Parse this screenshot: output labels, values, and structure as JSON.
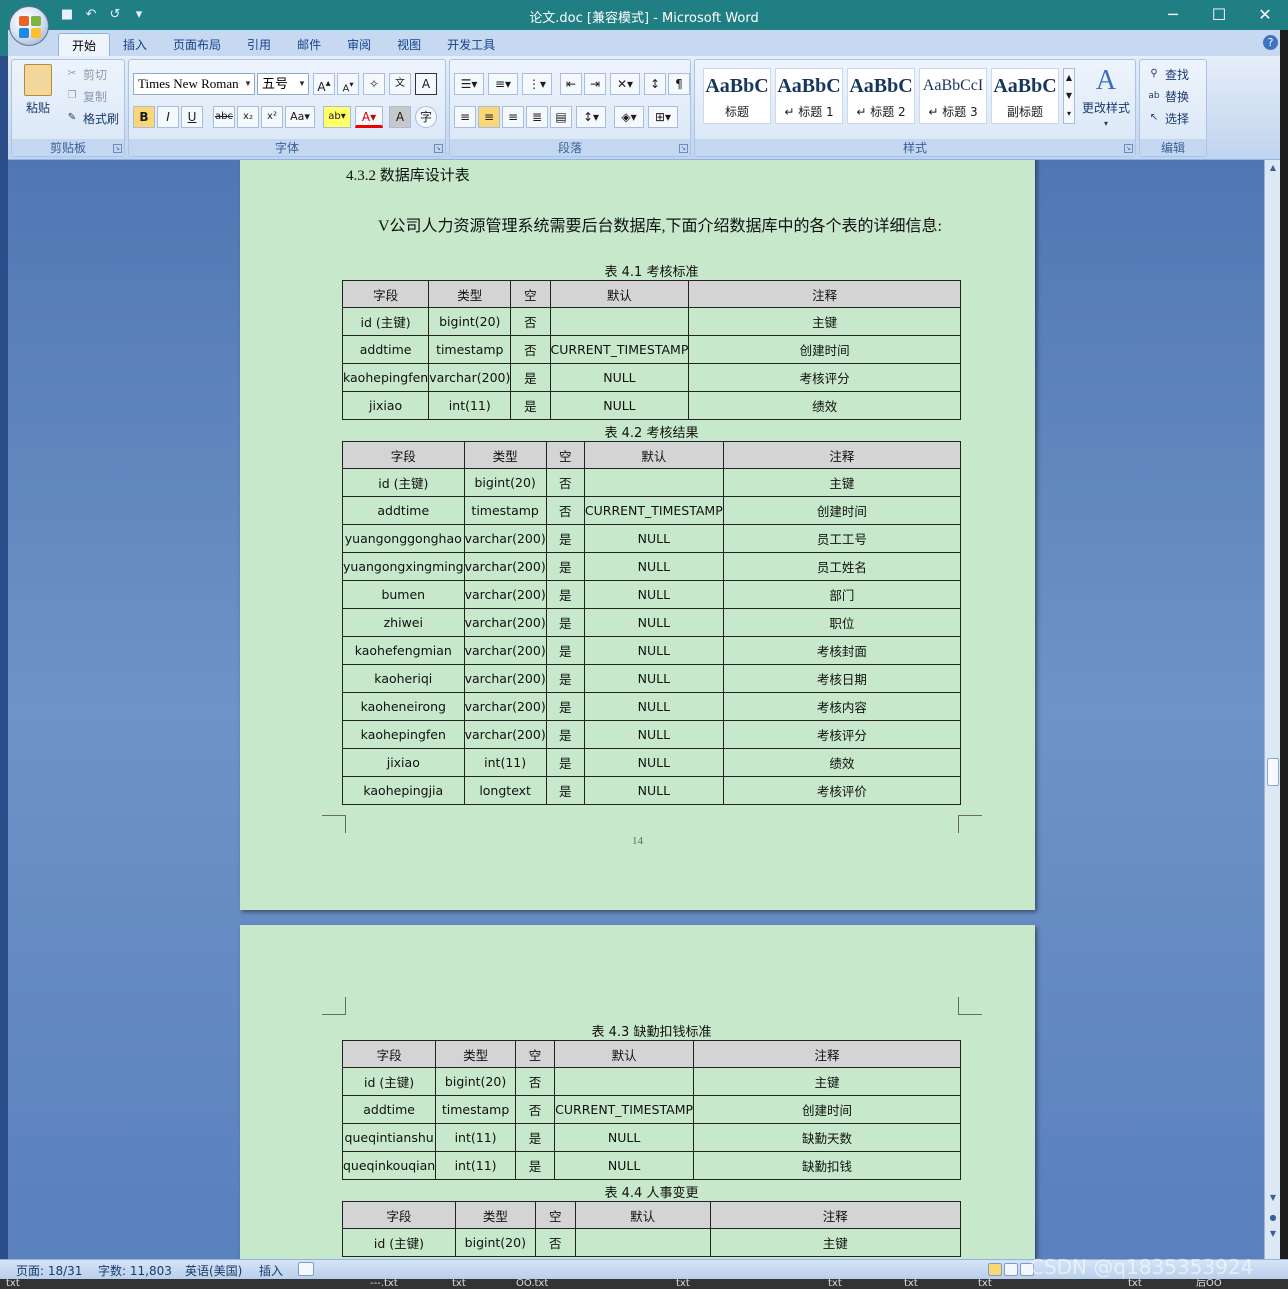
{
  "window": {
    "title": "论文.doc [兼容模式] - Microsoft Word",
    "min": "─",
    "max": "☐",
    "close": "✕"
  },
  "qat": {
    "save": "■",
    "undo": "↶",
    "redo": "↺",
    "customize": "▾"
  },
  "ribbon_tabs": [
    "开始",
    "插入",
    "页面布局",
    "引用",
    "邮件",
    "审阅",
    "视图",
    "开发工具"
  ],
  "clipboard": {
    "label": "剪贴板",
    "paste": "粘贴",
    "cut": "剪切",
    "copy": "复制",
    "format_painter": "格式刷"
  },
  "font": {
    "label": "字体",
    "font_name": "Times New Roman",
    "font_size": "五号"
  },
  "paragraph": {
    "label": "段落"
  },
  "styles": {
    "label": "样式",
    "items": [
      {
        "sample": "AaBbC",
        "name": "标题"
      },
      {
        "sample": "AaBbC",
        "name": "↵ 标题 1"
      },
      {
        "sample": "AaBbC",
        "name": "↵ 标题 2"
      },
      {
        "sample": "AaBbCcI",
        "name": "↵ 标题 3"
      },
      {
        "sample": "AaBbC",
        "name": "副标题"
      }
    ],
    "change_styles": "更改样式"
  },
  "editing": {
    "label": "编辑",
    "find": "查找",
    "replace": "替换",
    "select": "选择"
  },
  "page1": {
    "heading": "4.3.2 数据库设计表",
    "intro": "V公司人力资源管理系统需要后台数据库,下面介绍数据库中的各个表的详细信息:",
    "page_number": "14"
  },
  "columns": [
    "字段",
    "类型",
    "空",
    "默认",
    "注释"
  ],
  "tables": [
    {
      "caption": "表 4.1  考核标准",
      "rows": [
        [
          "id (主键)",
          "bigint(20)",
          "否",
          "",
          "主键"
        ],
        [
          "addtime",
          "timestamp",
          "否",
          "CURRENT_TIMESTAMP",
          "创建时间"
        ],
        [
          "kaohepingfen",
          "varchar(200)",
          "是",
          "NULL",
          "考核评分"
        ],
        [
          "jixiao",
          "int(11)",
          "是",
          "NULL",
          "绩效"
        ]
      ]
    },
    {
      "caption": "表 4.2  考核结果",
      "rows": [
        [
          "id (主键)",
          "bigint(20)",
          "否",
          "",
          "主键"
        ],
        [
          "addtime",
          "timestamp",
          "否",
          "CURRENT_TIMESTAMP",
          "创建时间"
        ],
        [
          "yuangonggonghao",
          "varchar(200)",
          "是",
          "NULL",
          "员工工号"
        ],
        [
          "yuangongxingming",
          "varchar(200)",
          "是",
          "NULL",
          "员工姓名"
        ],
        [
          "bumen",
          "varchar(200)",
          "是",
          "NULL",
          "部门"
        ],
        [
          "zhiwei",
          "varchar(200)",
          "是",
          "NULL",
          "职位"
        ],
        [
          "kaohefengmian",
          "varchar(200)",
          "是",
          "NULL",
          "考核封面"
        ],
        [
          "kaoheriqi",
          "varchar(200)",
          "是",
          "NULL",
          "考核日期"
        ],
        [
          "kaoheneirong",
          "varchar(200)",
          "是",
          "NULL",
          "考核内容"
        ],
        [
          "kaohepingfen",
          "varchar(200)",
          "是",
          "NULL",
          "考核评分"
        ],
        [
          "jixiao",
          "int(11)",
          "是",
          "NULL",
          "绩效"
        ],
        [
          "kaohepingjia",
          "longtext",
          "是",
          "NULL",
          "考核评价"
        ]
      ]
    },
    {
      "caption": "表 4.3  缺勤扣钱标准",
      "rows": [
        [
          "id (主键)",
          "bigint(20)",
          "否",
          "",
          "主键"
        ],
        [
          "addtime",
          "timestamp",
          "否",
          "CURRENT_TIMESTAMP",
          "创建时间"
        ],
        [
          "queqintianshu",
          "int(11)",
          "是",
          "NULL",
          "缺勤天数"
        ],
        [
          "queqinkouqian",
          "int(11)",
          "是",
          "NULL",
          "缺勤扣钱"
        ]
      ]
    },
    {
      "caption": "表 4.4  人事变更",
      "rows": [
        [
          "id (主键)",
          "bigint(20)",
          "否",
          "",
          "主键"
        ]
      ]
    }
  ],
  "status": {
    "page": "页面: 18/31",
    "words": "字数: 11,803",
    "language": "英语(美国)",
    "mode": "插入"
  },
  "taskbar": [
    "txt",
    "---.txt",
    "txt",
    "OO.txt",
    "txt",
    "txt",
    "txt",
    "txt",
    "txt",
    "后OO"
  ],
  "watermark": "CSDN @q1835353924"
}
